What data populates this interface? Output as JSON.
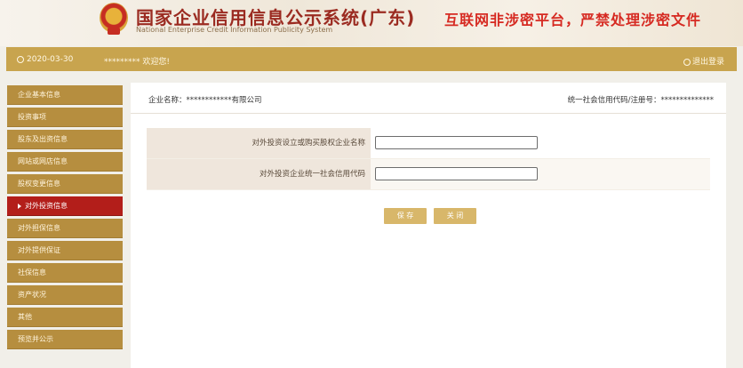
{
  "header": {
    "title": "国家企业信用信息公示系统(广东)",
    "subtitle": "National Enterprise Credit Information Publicity System",
    "warning": "互联网非涉密平台，严禁处理涉密文件"
  },
  "topbar": {
    "date": "2020-03-30",
    "welcome": "********* 欢迎您!",
    "logout": "退出登录"
  },
  "sidebar": {
    "items": [
      {
        "label": "企业基本信息"
      },
      {
        "label": "投资事项"
      },
      {
        "label": "股东及出资信息"
      },
      {
        "label": "网站或网店信息"
      },
      {
        "label": "股权变更信息"
      },
      {
        "label": "对外投资信息"
      },
      {
        "label": "对外担保信息"
      },
      {
        "label": "对外提供保证"
      },
      {
        "label": "社保信息"
      },
      {
        "label": "资产状况"
      },
      {
        "label": "其他"
      },
      {
        "label": "预览并公示"
      }
    ]
  },
  "main": {
    "company_label": "企业名称：",
    "company_value": "************有限公司",
    "credit_label": "统一社会信用代码/注册号：",
    "credit_value": "**************"
  },
  "form": {
    "field1_label": "对外投资设立或购买股权企业名称",
    "field1_value": "",
    "field2_label": "对外投资企业统一社会信用代码",
    "field2_value": ""
  },
  "buttons": {
    "save": "保 存",
    "cancel": "关 闭"
  },
  "colors": {
    "gold": "#c8a44e",
    "menu": "#b68e3f",
    "active": "#b31e1a",
    "warning_red": "#d62a22"
  }
}
